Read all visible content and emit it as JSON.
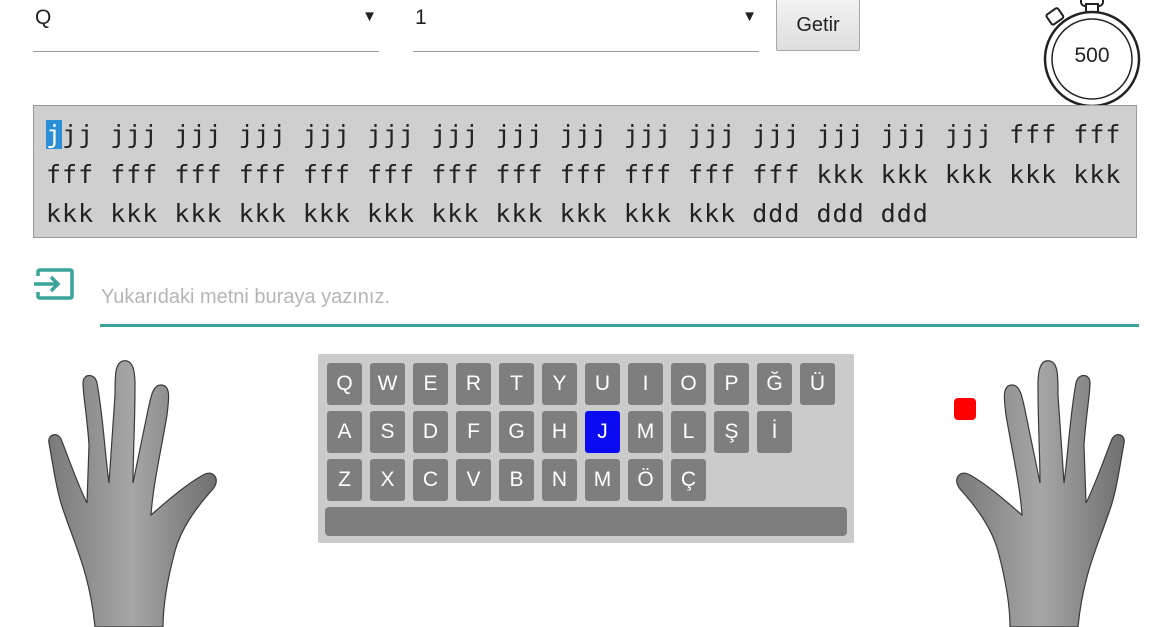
{
  "controls": {
    "layout_select": "Q",
    "level_select": "1",
    "fetch_label": "Getir"
  },
  "timer": {
    "value": "500"
  },
  "practice": {
    "current_char": "j",
    "remaining_text": "jj jjj jjj jjj jjj jjj jjj jjj jjj jjj jjj jjj jjj jjj jjj fff fff fff fff fff fff fff fff fff fff fff fff fff fff kkk kkk kkk kkk kkk kkk kkk kkk kkk kkk kkk kkk kkk kkk kkk kkk ddd ddd ddd"
  },
  "input": {
    "placeholder": "Yukarıdaki metni buraya yazınız."
  },
  "keyboard": {
    "row1": [
      "Q",
      "W",
      "E",
      "R",
      "T",
      "Y",
      "U",
      "I",
      "O",
      "P",
      "Ğ",
      "Ü"
    ],
    "row2": [
      "A",
      "S",
      "D",
      "F",
      "G",
      "H",
      "J",
      "M",
      "L",
      "Ş",
      "İ"
    ],
    "row3": [
      "Z",
      "X",
      "C",
      "V",
      "B",
      "N",
      "M",
      "Ö",
      "Ç"
    ],
    "active_key": "J"
  },
  "colors": {
    "active_key": "#0a0bf0",
    "key": "#7e7e7e",
    "input_accent": "#3ba39a",
    "cursor_highlight": "#2a8fd6",
    "finger_marker": "#ff0000"
  },
  "icons": {
    "input": "input-icon",
    "timer": "stopwatch-icon"
  }
}
